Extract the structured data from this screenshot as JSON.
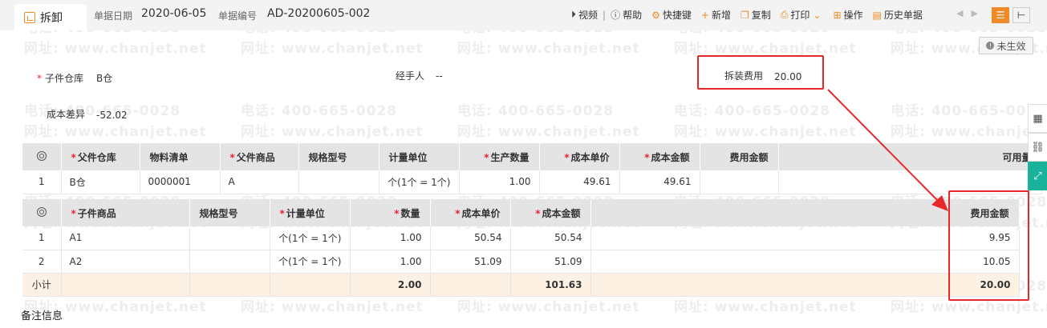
{
  "tab": {
    "label": "拆卸"
  },
  "header": {
    "date_label": "单据日期",
    "date_value": "2020-06-05",
    "no_label": "单据编号",
    "no_value": "AD-20200605-002"
  },
  "toolbar": {
    "video": "视频",
    "help": "帮助",
    "shortcut": "快捷键",
    "add": "新增",
    "copy": "复制",
    "print": "打印",
    "operate": "操作",
    "history": "历史单据",
    "separator": "|"
  },
  "status": {
    "label": "未生效"
  },
  "form": {
    "sub_warehouse_label": "子件仓库",
    "sub_warehouse_value": "B仓",
    "handler_label": "经手人",
    "handler_value": "--",
    "fee_label": "拆装费用",
    "fee_value": "20.00",
    "cost_diff_label": "成本差异",
    "cost_diff_value": "-52.02"
  },
  "parent_table": {
    "headers": [
      "父件仓库",
      "物料清单",
      "父件商品",
      "规格型号",
      "计量单位",
      "生产数量",
      "成本单价",
      "成本金额",
      "费用金额",
      "可用量"
    ],
    "row": {
      "no": "1",
      "warehouse": "B仓",
      "bom": "0000001",
      "product": "A",
      "spec": "",
      "unit": "个(1个 = 1个)",
      "qty": "1.00",
      "unit_cost": "49.61",
      "amount": "49.61",
      "fee": "",
      "available": ""
    }
  },
  "child_table": {
    "headers": [
      "子件商品",
      "规格型号",
      "计量单位",
      "数量",
      "成本单价",
      "成本金额",
      "费用金额"
    ],
    "rows": [
      {
        "no": "1",
        "product": "A1",
        "spec": "",
        "unit": "个(1个 = 1个)",
        "qty": "1.00",
        "unit_cost": "50.54",
        "amount": "50.54",
        "fee": "9.95"
      },
      {
        "no": "2",
        "product": "A2",
        "spec": "",
        "unit": "个(1个 = 1个)",
        "qty": "1.00",
        "unit_cost": "51.09",
        "amount": "51.09",
        "fee": "10.05"
      }
    ],
    "subtotal": {
      "label": "小计",
      "qty": "2.00",
      "amount": "101.63",
      "fee": "20.00"
    }
  },
  "notes": {
    "title": "备注信息"
  },
  "watermark": {
    "phone": "电话: 400-665-0028",
    "site": "网址: www.chanjet.net"
  },
  "colors": {
    "accent": "#f08a24",
    "highlight": "#e8272a",
    "side_active": "#18b39a"
  }
}
